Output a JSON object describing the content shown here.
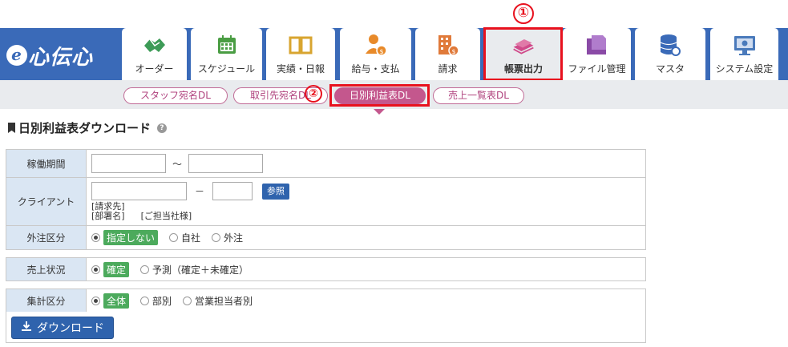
{
  "logo": {
    "e": "e",
    "text": "心伝心"
  },
  "nav": [
    {
      "label": "オーダー",
      "icon": "handshake-icon",
      "color": "#3d9b57"
    },
    {
      "label": "スケジュール",
      "icon": "calendar-icon",
      "color": "#4a9d43"
    },
    {
      "label": "実績・日報",
      "icon": "book-icon",
      "color": "#d8a530"
    },
    {
      "label": "給与・支払",
      "icon": "payment-person-icon",
      "color": "#e88a2a"
    },
    {
      "label": "請求",
      "icon": "building-invoice-icon",
      "color": "#e07a3a"
    },
    {
      "label": "帳票出力",
      "icon": "papers-icon",
      "color": "#d04a8a"
    },
    {
      "label": "ファイル管理",
      "icon": "folder-icon",
      "color": "#8a4aa6"
    },
    {
      "label": "マスタ",
      "icon": "database-gear-icon",
      "color": "#3a6ab8"
    },
    {
      "label": "システム設定",
      "icon": "monitor-settings-icon",
      "color": "#4a7abb"
    }
  ],
  "annotations": {
    "one": "①",
    "two": "②"
  },
  "subnav": [
    {
      "label": "スタッフ宛名DL"
    },
    {
      "label": "取引先宛名DL"
    },
    {
      "label": "日別利益表DL"
    },
    {
      "label": "売上一覧表DL"
    }
  ],
  "page": {
    "title": "日別利益表ダウンロード",
    "help": "?"
  },
  "form": {
    "period": {
      "label": "稼働期間",
      "from": "",
      "to": "",
      "sep": "～"
    },
    "client": {
      "label": "クライアント",
      "code1": "",
      "code2": "",
      "sep": "－",
      "ref_button": "参照",
      "billing": "[請求先]",
      "dept": "[部署名]",
      "rep": "[ご担当社様]"
    },
    "outsource": {
      "label": "外注区分",
      "options": [
        "指定しない",
        "自社",
        "外注"
      ],
      "selected": 0
    },
    "sales_status": {
      "label": "売上状況",
      "options": [
        "確定",
        "予測（確定＋未確定）"
      ],
      "selected": 0
    },
    "aggregation": {
      "label": "集計区分",
      "options": [
        "全体",
        "部別",
        "営業担当者別"
      ],
      "selected": 0
    }
  },
  "download_button": "ダウンロード"
}
